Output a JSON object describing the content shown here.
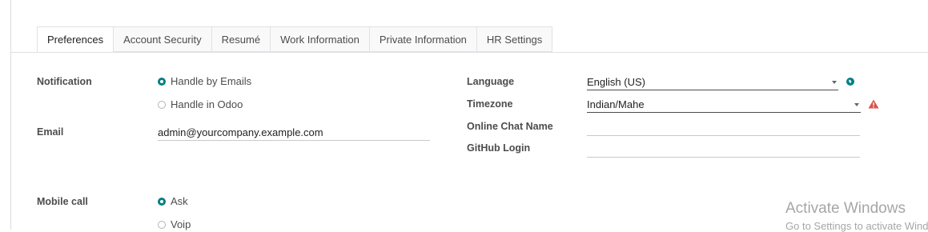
{
  "tabs": [
    {
      "label": "Preferences"
    },
    {
      "label": "Account Security"
    },
    {
      "label": "Resumé"
    },
    {
      "label": "Work Information"
    },
    {
      "label": "Private Information"
    },
    {
      "label": "HR Settings"
    }
  ],
  "active_tab": "Preferences",
  "left": {
    "notification": {
      "label": "Notification",
      "options": [
        {
          "label": "Handle by Emails",
          "checked": true
        },
        {
          "label": "Handle in Odoo",
          "checked": false
        }
      ]
    },
    "email": {
      "label": "Email",
      "value": "admin@yourcompany.example.com"
    },
    "mobile_call": {
      "label": "Mobile call",
      "options": [
        {
          "label": "Ask",
          "checked": true
        },
        {
          "label": "Voip",
          "checked": false
        }
      ]
    }
  },
  "right": {
    "language": {
      "label": "Language",
      "value": "English (US)",
      "icon": "globe-icon"
    },
    "timezone": {
      "label": "Timezone",
      "value": "Indian/Mahe",
      "icon": "warning-icon"
    },
    "online_chat": {
      "label": "Online Chat Name",
      "value": ""
    },
    "github": {
      "label": "GitHub Login",
      "value": ""
    }
  },
  "watermark": {
    "line1": "Activate Windows",
    "line2": "Go to Settings to activate Windows."
  },
  "colors": {
    "accent": "#017e84",
    "warning": "#d9534f"
  }
}
